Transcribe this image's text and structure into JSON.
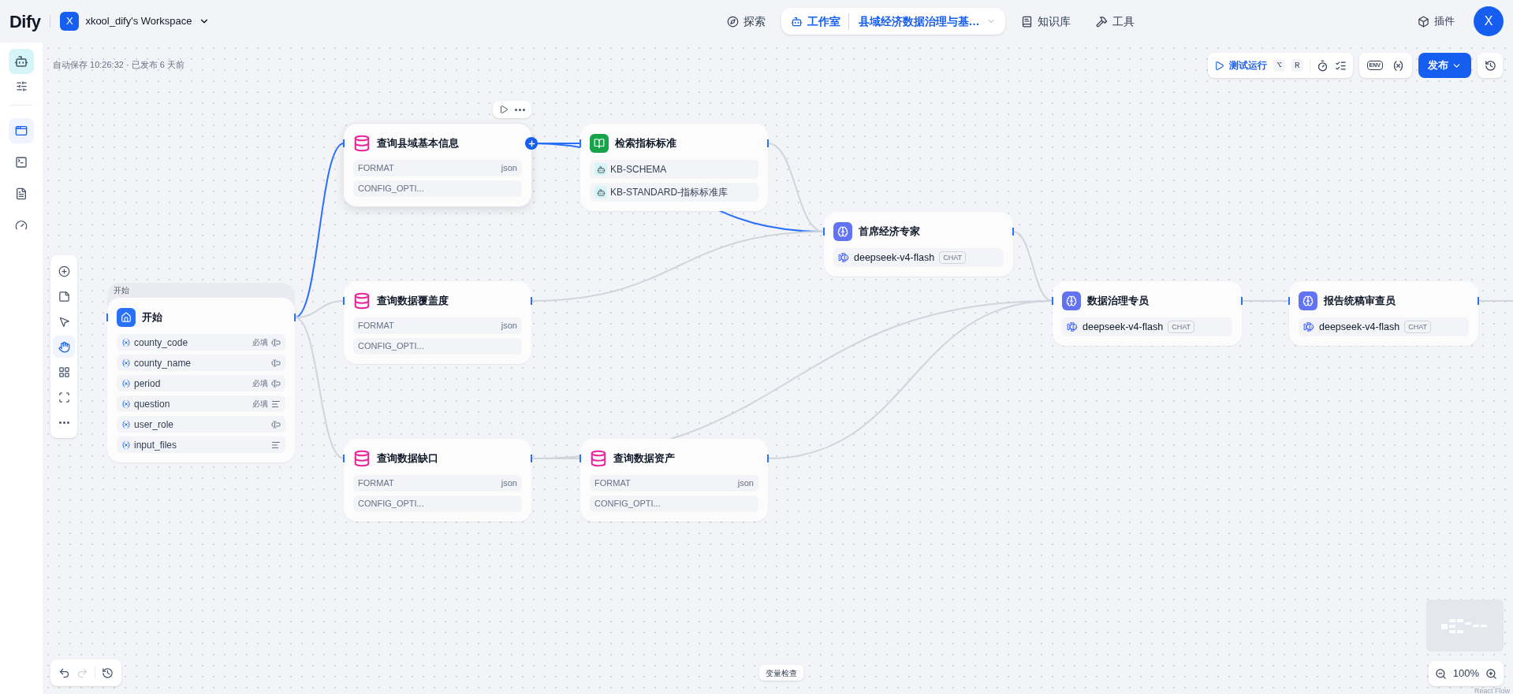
{
  "topbar": {
    "logo": "Dify",
    "workspace": {
      "initial": "X",
      "name": "xkool_dify's Workspace"
    },
    "nav": [
      {
        "label": "探索",
        "kind": "explore",
        "selected": false
      },
      {
        "label": "工作室",
        "kind": "studio",
        "selected": true,
        "app_name": "县域经济数据治理与基…"
      },
      {
        "label": "知识库",
        "kind": "knowledge",
        "selected": false
      },
      {
        "label": "工具",
        "kind": "tools",
        "selected": false
      }
    ],
    "plugins": "插件",
    "avatar": "X"
  },
  "sidebar": {
    "items": [
      {
        "kind": "orchestrate",
        "selected": true
      },
      {
        "kind": "api",
        "selected": false
      },
      {
        "kind": "logs",
        "selected": false
      },
      {
        "kind": "monitor",
        "selected": false
      }
    ]
  },
  "status": "自动保存 10:26:32 · 已发布 6 天前",
  "toolbar": {
    "test_run": "测试运行",
    "keys": [
      "⌥",
      "R"
    ],
    "env": "ENV",
    "publish": "发布"
  },
  "canvas_tools": [
    {
      "kind": "add",
      "selected": false
    },
    {
      "kind": "note",
      "selected": false
    },
    {
      "kind": "pointer",
      "selected": false
    },
    {
      "kind": "hand",
      "selected": true
    },
    {
      "kind": "organize",
      "selected": false
    },
    {
      "kind": "fit",
      "selected": false
    },
    {
      "kind": "more",
      "selected": false
    }
  ],
  "nodes": [
    {
      "kind": "start",
      "group_label": "开始",
      "title": "开始",
      "selected": false,
      "variables": [
        {
          "name": "county_code",
          "required": "必填",
          "kind": "line"
        },
        {
          "name": "county_name",
          "kind": "line"
        },
        {
          "name": "period",
          "required": "必填",
          "kind": "line"
        },
        {
          "name": "question",
          "required": "必填",
          "kind": "paragraph"
        },
        {
          "name": "user_role",
          "kind": "line"
        },
        {
          "name": "input_files",
          "kind": "paragraph"
        }
      ]
    },
    {
      "kind": "tool",
      "title": "查询县域基本信息",
      "selected": true,
      "params": [
        {
          "key": "FORMAT",
          "value": "json"
        },
        {
          "key": "CONFIG_OPTI..."
        }
      ]
    },
    {
      "kind": "knowledge",
      "title": "检索指标标准",
      "selected": false,
      "datasets": [
        "KB-SCHEMA",
        "KB-STANDARD-指标标准库"
      ]
    },
    {
      "kind": "llm",
      "title": "首席经济专家",
      "selected": false,
      "model": "deepseek-v4-flash",
      "mode": "CHAT"
    },
    {
      "kind": "tool",
      "title": "查询数据覆盖度",
      "selected": false,
      "params": [
        {
          "key": "FORMAT",
          "value": "json"
        },
        {
          "key": "CONFIG_OPTI..."
        }
      ]
    },
    {
      "kind": "llm",
      "title": "数据治理专员",
      "selected": false,
      "model": "deepseek-v4-flash",
      "mode": "CHAT"
    },
    {
      "kind": "llm",
      "title": "报告统稿审查员",
      "selected": false,
      "model": "deepseek-v4-flash",
      "mode": "CHAT"
    },
    {
      "kind": "tool",
      "title": "查询数据缺口",
      "selected": false,
      "params": [
        {
          "key": "FORMAT",
          "value": "json"
        },
        {
          "key": "CONFIG_OPTI..."
        }
      ]
    },
    {
      "kind": "tool",
      "title": "查询数据资产",
      "selected": false,
      "params": [
        {
          "key": "FORMAT",
          "value": "json"
        },
        {
          "key": "CONFIG_OPTI..."
        }
      ]
    }
  ],
  "variable_inspect": "变量检查",
  "zoom": "100%",
  "attribution": "React Flow"
}
